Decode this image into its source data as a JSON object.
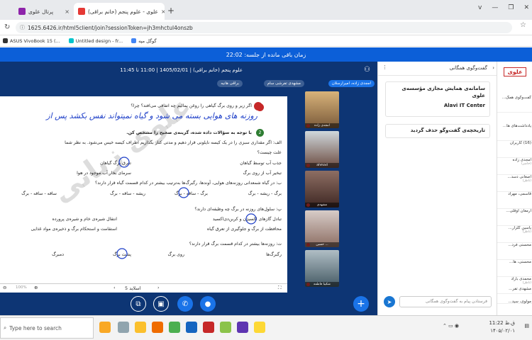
{
  "browser": {
    "tabs": [
      {
        "title": "پرتال علوی",
        "close": "×"
      },
      {
        "title": "علوی - علوم پنجم (خانم براقی)",
        "close": "×"
      }
    ],
    "new_tab": "+",
    "window_controls": [
      "v",
      "—",
      "❐",
      "✕"
    ],
    "url": "1625.6426.ir/html5client/join?sessionToken=jh3mhctul4onszb",
    "bookmarks": [
      "ASUS VivoBook 15 (...",
      "Untitled design - fr...",
      "گوگل مپه"
    ]
  },
  "timer": "زمان باقی مانده از جلسه: 22:02",
  "session": {
    "title": "علوم پنجم (خانم براقی) | 1405/02/01 | 11:00 تا 11:45",
    "chips": [
      "براقی هانیه",
      "مشهدی تفرشی سام",
      "امجدی زاده، امیرارسلان"
    ]
  },
  "slide": {
    "watermark": "علوی زبانی",
    "q_top": "اگر زیر و روی برگ گیاهی را روغن بمالیم چه اتفاقی می‌افتد؟ چرا؟",
    "handwriting": "روزنه های هوایی بسته می شود و گیاه نمیتواند نفس بکشد پس از",
    "intro": "با توجه به سؤالات داده شده، گزینه‌ی صحیح را مشخص کن.",
    "a_text": "الف: اگر مقداری سبزی را در یک کیسه نایلونی قرار دهیم و مدتی کنار بگذاریم اطراف کیسه خیس می‌شود. به نظر شما",
    "a_text2": "علت چیست؟",
    "a_opts": [
      "جذب آب توسط گیاهان",
      "تعرق برگ گیاهان",
      "تبخیر آب از روی برگ",
      "سرمای بخار آب موجود در هوا"
    ],
    "b_text": "ب: در گیاه شمعدانی روزنه‌های هوایی، آوندها، رگبرگ‌ها به‌ترتیب بیشتر در کدام قسمت گیاه قرار دارند؟",
    "b_opts": [
      "برگ - ریشه - برگ",
      "برگ - ساقه - برگ",
      "ریشه - ساقه - برگ",
      "ساقه - ساقه - برگ"
    ],
    "c_text": "پ: سلول‌های روزنه در برگ چه وظیفه‌ای دارند؟",
    "c_opts": [
      "تبادل گازهای اکسیژن و کربن‌دی‌اکسید",
      "انتقال شیره‌ی خام و شیره‌ی پرورده",
      "محافظت از برگ و جلوگیری از تعرق گیاه",
      "استقامت و استحکام برگ و ذخیره‌ی مواد غذایی"
    ],
    "d_text": "ت: روزنه‌ها بیشتر در کدام قسمت برگ قرار دارند؟",
    "d_opts": [
      "رگبرگ‌ها",
      "روی برگ",
      "پشت برگ",
      "دمبرگ"
    ],
    "nums": {
      "q1": "1",
      "q2": "2"
    },
    "slide_label": "اسلاید 5",
    "zoom": "100%"
  },
  "videos": [
    {
      "name": "امجدی زاده"
    },
    {
      "name": "ahmad"
    },
    {
      "name": "مشهدی"
    },
    {
      "name": "حسین ..."
    },
    {
      "name": "شکیبا فاطمه"
    }
  ],
  "chat": {
    "header": "گفت‌وگوی همگانی",
    "card1_title": "سامانه‌ی همایش مجازی مؤسسه‌ی علوی",
    "card1_sub": "Alavi IT Center",
    "card2": "تاریخچه‌ی گفت‌وگو حذف گردید",
    "input_placeholder": "فرستادن پیام به گفت‌وگوی همگانی"
  },
  "users": {
    "logo": "علوی",
    "items": [
      "گفت‌وگوی همگ...",
      "یادداشت‌های ها...",
      "(16) کاربران",
      "امجدی زاده",
      "اصغانی دسد...",
      "قاسمی، مهراد",
      "ارمغان اوقلی...",
      "یاسین گلزار...",
      "محسنی فرد...",
      "محسنی، ها...",
      "محمدی باراد",
      "مشهدی تفر...",
      "مولوی، سید..."
    ],
    "subs": [
      "",
      "",
      "",
      "(حاضر)",
      "(ناظر)",
      "",
      "",
      "(ناظر)",
      "",
      "",
      "(ناظر)",
      "",
      ""
    ]
  },
  "taskbar": {
    "search": "Type here to search",
    "time": "11:22 ق.ظ",
    "date": "۱۴۰۵/۰۲/۰۱"
  }
}
